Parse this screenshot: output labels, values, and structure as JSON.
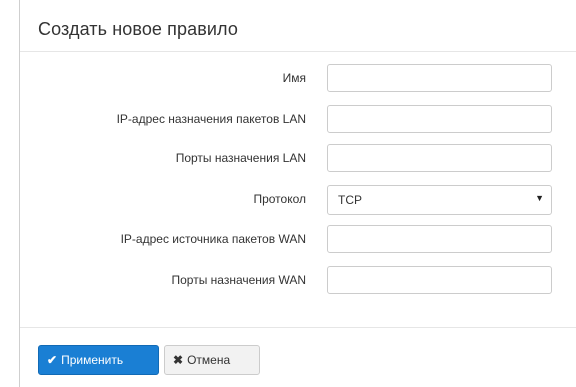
{
  "form": {
    "title": "Создать новое правило",
    "fields": [
      {
        "label": "Имя",
        "type": "text",
        "value": ""
      },
      {
        "label": "IP-адрес назначения пакетов LAN",
        "type": "text",
        "value": ""
      },
      {
        "label": "Порты назначения LAN",
        "type": "text",
        "value": ""
      },
      {
        "label": "Протокол",
        "type": "select",
        "value": "TCP"
      },
      {
        "label": "IP-адрес источника пакетов WAN",
        "type": "text",
        "value": ""
      },
      {
        "label": "Порты назначения WAN",
        "type": "text",
        "value": ""
      }
    ]
  },
  "buttons": {
    "apply_label": "Применить",
    "cancel_label": "Отмена"
  },
  "icons": {
    "apply": "check-icon",
    "cancel": "close-icon",
    "select": "caret-down-icon"
  },
  "colors": {
    "primary": "#1a7fd4",
    "border": "#cccccc"
  }
}
